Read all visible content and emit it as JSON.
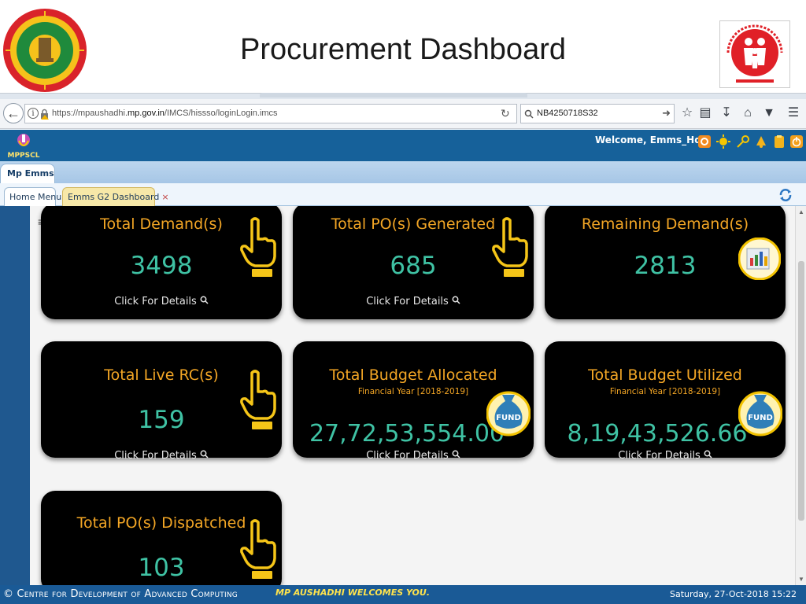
{
  "slide": {
    "title": "Procurement Dashboard"
  },
  "browser": {
    "url_prefix": "https://mpaushadhi.",
    "url_domain": "mp.gov.in",
    "url_path": "/IMCS/hissso/loginLogin.imcs",
    "search_value": "NB4250718S32"
  },
  "app": {
    "logo_text": "MPPSCL",
    "welcome": "Welcome, Emms_Hq",
    "module_tab": "Mp Emms",
    "tabs": [
      {
        "label": "Home Menu"
      },
      {
        "label": "Emms G2 Dashboard",
        "close": "×"
      }
    ]
  },
  "cards": [
    {
      "title": "Total Demand(s)",
      "value": "3498",
      "details": "Click For Details",
      "icon": "hand-pointer-icon"
    },
    {
      "title": "Total PO(s) Generated",
      "value": "685",
      "details": "Click For Details",
      "icon": "hand-pointer-icon"
    },
    {
      "title": "Remaining Demand(s)",
      "value": "2813",
      "icon": "report-chart-icon"
    },
    {
      "title": "Total Live RC(s)",
      "value": "159",
      "details": "Click For Details",
      "icon": "hand-pointer-icon"
    },
    {
      "title": "Total Budget Allocated",
      "subtitle": "Financial Year [2018-2019]",
      "value": "27,72,53,554.00",
      "details": "Click For Details",
      "icon": "fund-bag-icon",
      "icon_label": "FUND"
    },
    {
      "title": "Total Budget Utilized",
      "subtitle": "Financial Year [2018-2019]",
      "value": "8,19,43,526.66",
      "details": "Click For Details",
      "icon": "fund-bag-icon",
      "icon_label": "FUND"
    },
    {
      "title": "Total PO(s) Dispatched",
      "value": "103",
      "icon": "hand-pointer-icon"
    }
  ],
  "footer": {
    "left": "© Centre for Development of Advanced Computing",
    "middle": "MP AUSHADHI WELCOMES YOU.",
    "right": "Saturday, 27-Oct-2018 15:22"
  },
  "colors": {
    "card_bg": "#000000",
    "card_title": "#f3a625",
    "card_value": "#3fc2a4",
    "header_blue": "#16619a",
    "footer_blue": "#1a5a96"
  }
}
